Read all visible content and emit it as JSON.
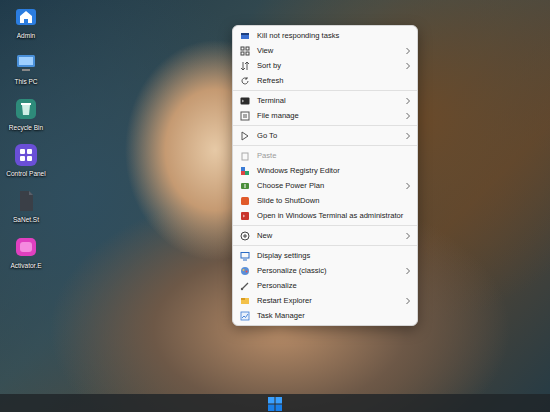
{
  "desktop": {
    "icons": [
      {
        "label": "Admin"
      },
      {
        "label": "This PC"
      },
      {
        "label": "Recycle Bin"
      },
      {
        "label": "Control Panel"
      },
      {
        "label": "SaNet.St"
      },
      {
        "label": "Activator.E"
      }
    ]
  },
  "menu": {
    "items": [
      {
        "kind": "item",
        "label": "Kill not responding tasks",
        "submenu": false,
        "disabled": false
      },
      {
        "kind": "item",
        "label": "View",
        "submenu": true,
        "disabled": false
      },
      {
        "kind": "item",
        "label": "Sort by",
        "submenu": true,
        "disabled": false
      },
      {
        "kind": "item",
        "label": "Refresh",
        "submenu": false,
        "disabled": false
      },
      {
        "kind": "separator"
      },
      {
        "kind": "item",
        "label": "Terminal",
        "submenu": true,
        "disabled": false
      },
      {
        "kind": "item",
        "label": "File manage",
        "submenu": true,
        "disabled": false
      },
      {
        "kind": "separator"
      },
      {
        "kind": "item",
        "label": "Go To",
        "submenu": true,
        "disabled": false
      },
      {
        "kind": "separator"
      },
      {
        "kind": "item",
        "label": "Paste",
        "submenu": false,
        "disabled": true
      },
      {
        "kind": "item",
        "label": "Windows Registry Editor",
        "submenu": false,
        "disabled": false
      },
      {
        "kind": "item",
        "label": "Choose Power Plan",
        "submenu": true,
        "disabled": false
      },
      {
        "kind": "item",
        "label": "Slide to ShutDown",
        "submenu": false,
        "disabled": false
      },
      {
        "kind": "item",
        "label": "Open in Windows Terminal as administrator",
        "submenu": false,
        "disabled": false
      },
      {
        "kind": "separator"
      },
      {
        "kind": "item",
        "label": "New",
        "submenu": true,
        "disabled": false
      },
      {
        "kind": "separator"
      },
      {
        "kind": "item",
        "label": "Display settings",
        "submenu": false,
        "disabled": false
      },
      {
        "kind": "item",
        "label": "Personalize (classic)",
        "submenu": true,
        "disabled": false
      },
      {
        "kind": "item",
        "label": "Personalize",
        "submenu": false,
        "disabled": false
      },
      {
        "kind": "item",
        "label": "Restart Explorer",
        "submenu": true,
        "disabled": false
      },
      {
        "kind": "item",
        "label": "Task Manager",
        "submenu": false,
        "disabled": false
      }
    ]
  },
  "taskbar": {
    "start": {
      "pressed": false
    }
  }
}
